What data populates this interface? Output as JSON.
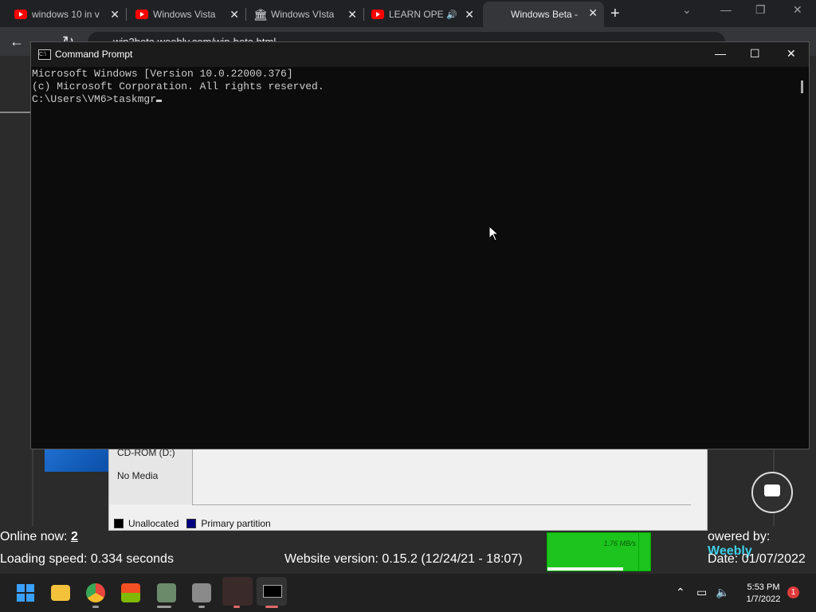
{
  "browser": {
    "tabs": [
      {
        "title": "windows 10 in v",
        "icon": "youtube-icon"
      },
      {
        "title": "Windows Vista",
        "icon": "youtube-icon"
      },
      {
        "title": "Windows VIsta",
        "icon": "museum-icon"
      },
      {
        "title": "LEARN OPE",
        "icon": "youtube-icon"
      },
      {
        "title": "Windows Beta -",
        "icon": "none",
        "active": true
      }
    ],
    "url": "win2beta.weebly.com/win-beta.html"
  },
  "site": {
    "disk": {
      "drive": "CD-ROM (D:)",
      "status": "No Media"
    },
    "legend": [
      {
        "label": "Unallocated",
        "color": "#000000"
      },
      {
        "label": "Primary partition",
        "color": "#000080"
      }
    ],
    "online_label": "Online now:",
    "online_count": "2",
    "powered_label": "owered by:",
    "powered_brand": "Weebly",
    "loading": "Loading speed: 0.334 seconds",
    "version": "Website version: 0.15.2 (12/24/21 - 18:07)",
    "date": "Date: 01/07/2022",
    "net_rate": "1.76 MB/s"
  },
  "cmd": {
    "title": "Command Prompt",
    "lines": [
      "Microsoft Windows [Version 10.0.22000.376]",
      "(c) Microsoft Corporation. All rights reserved.",
      "",
      "C:\\Users\\VM6>taskmgr"
    ]
  },
  "taskbar": {
    "time": "5:53 PM",
    "date": "1/7/2022",
    "notifications": "1"
  }
}
